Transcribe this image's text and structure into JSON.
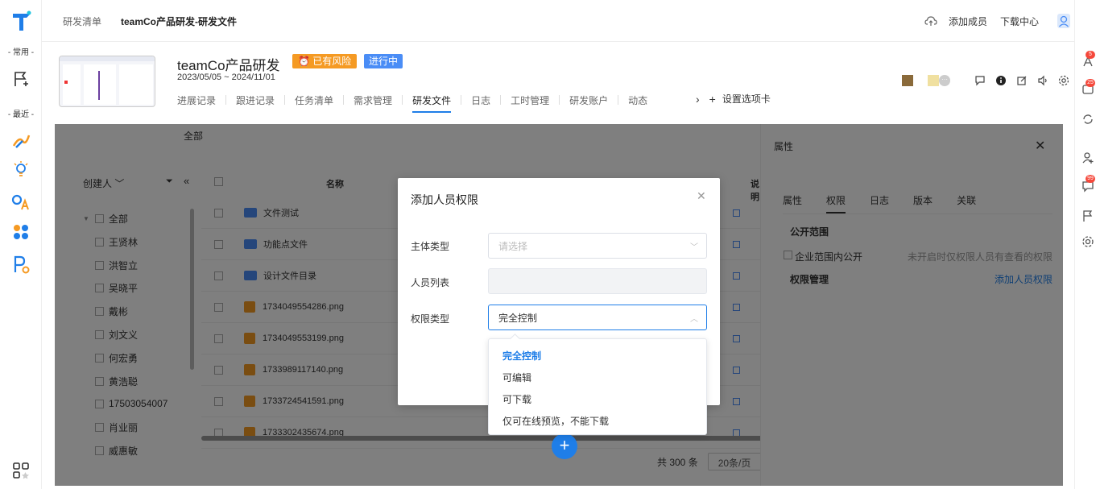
{
  "header": {
    "breadcrumb_parent": "研发清单",
    "breadcrumb_current": "teamCo产品研发-研发文件",
    "add_member": "添加成员",
    "download_center": "下载中心"
  },
  "left_rail": {
    "section_common": "- 常用 -",
    "section_recent": "- 最近 -"
  },
  "right_rail": {
    "badges": [
      "5",
      "25",
      "99"
    ]
  },
  "project": {
    "title": "teamCo产品研发",
    "risk_badge": "已有风险",
    "status_badge": "进行中",
    "date_range": "2023/05/05 ~ 2024/11/01",
    "tabs": [
      "进展记录",
      "跟进记录",
      "任务清单",
      "需求管理",
      "研发文件",
      "日志",
      "工时管理",
      "研发账户",
      "动态"
    ],
    "active_tab": "研发文件",
    "tab_settings": "设置选项卡"
  },
  "files": {
    "all_label": "全部",
    "creator_filter": "创建人",
    "tree_items": [
      "全部",
      "王贤林",
      "洪智立",
      "吴晓平",
      "戴彬",
      "刘文义",
      "何宏勇",
      "黄浩聪",
      "17503054007",
      "肖业丽",
      "威惠敏"
    ],
    "column_name": "名称",
    "column_desc": "说明",
    "rows": [
      {
        "name": "文件测试",
        "type": "folder"
      },
      {
        "name": "功能点文件",
        "type": "folder"
      },
      {
        "name": "设计文件目录",
        "type": "folder"
      },
      {
        "name": "1734049554286.png",
        "type": "image"
      },
      {
        "name": "1734049553199.png",
        "type": "image"
      },
      {
        "name": "1733989117140.png",
        "type": "image"
      },
      {
        "name": "1733724541591.png",
        "type": "image"
      },
      {
        "name": "1733302435674.png",
        "type": "image"
      }
    ],
    "total": "共 300 条",
    "page_size": "20条/页"
  },
  "side_panel": {
    "title": "属性",
    "tabs": [
      "属性",
      "权限",
      "日志",
      "版本",
      "关联"
    ],
    "active_tab": "权限",
    "public_scope": "公开范围",
    "enterprise_public": "企业范围内公开",
    "enterprise_hint": "未开启时仅权限人员有查看的权限",
    "perm_manage": "权限管理",
    "add_perm": "添加人员权限"
  },
  "modal": {
    "title": "添加人员权限",
    "subject_type_label": "主体类型",
    "subject_type_placeholder": "请选择",
    "member_list_label": "人员列表",
    "perm_type_label": "权限类型",
    "perm_type_value": "完全控制",
    "options": [
      "完全控制",
      "可编辑",
      "可下载",
      "仅可在线预览，不能下载"
    ],
    "selected_option": "完全控制"
  },
  "colors": {
    "primary": "#1f7ee8",
    "risk": "#f59a23",
    "running": "#4a8df6",
    "badge_red": "#f5483b"
  }
}
